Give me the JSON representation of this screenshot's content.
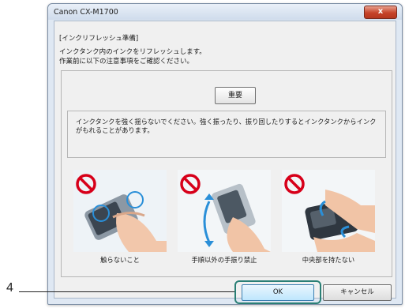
{
  "window": {
    "title": "Canon CX-M1700",
    "close_label": "x"
  },
  "content": {
    "heading": "[インクリフレッシュ準備]",
    "desc_line1": "インクタンク内のインクをリフレッシュします。",
    "desc_line2": "作業前に以下の注意事項をご確認ください。",
    "important_button": "重要",
    "warning_text": "インクタンクを強く揺らないでください。強く振ったり、振り回したりするとインクタンクからインクがもれることがあります。"
  },
  "photos": [
    {
      "caption": "触らないこと"
    },
    {
      "caption": "手順以外の手振り禁止"
    },
    {
      "caption": "中央部を持たない"
    }
  ],
  "buttons": {
    "ok": "OK",
    "cancel": "キャンセル"
  },
  "callout": {
    "number": "4"
  },
  "colors": {
    "prohibit_red": "#d7001a",
    "highlight": "#2a7f75",
    "arrow_blue": "#2a8fd8"
  }
}
